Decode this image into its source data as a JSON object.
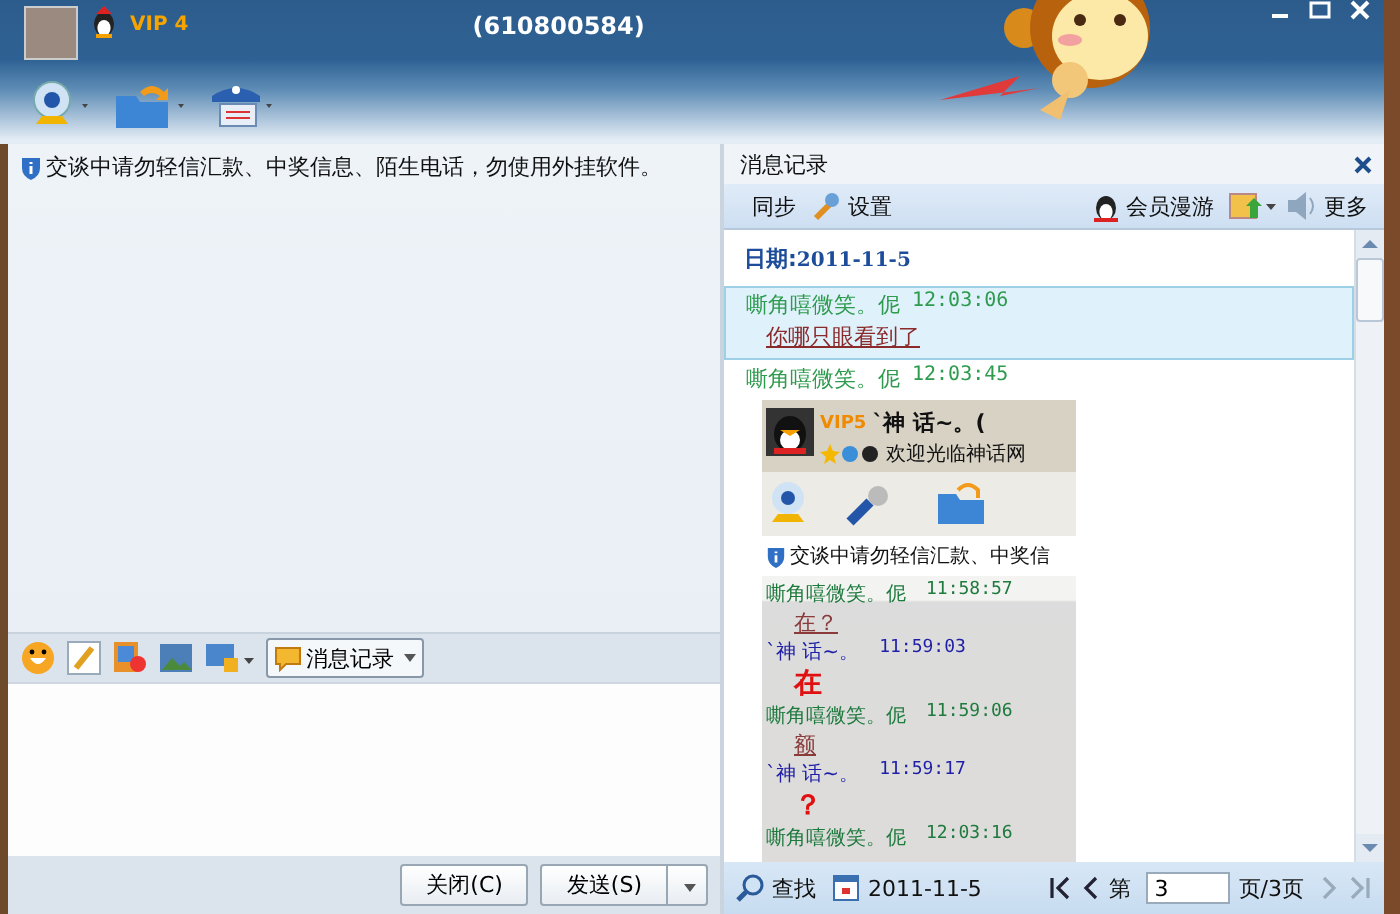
{
  "window": {
    "badge": "VIP 4",
    "title": "(610800584)"
  },
  "notice": "交谈中请勿轻信汇款、中奖信息、陌生电话，勿使用外挂软件。",
  "format_toolbar": {
    "history_button": "消息记录"
  },
  "buttons": [
    {
      "label": "关闭(C)",
      "kind": "plain"
    },
    {
      "label": "发送(S)",
      "kind": "split"
    }
  ],
  "history": {
    "title": "消息记录",
    "toolbar_left": [
      "同步",
      "设置"
    ],
    "toolbar_right": [
      "会员漫游",
      "更多"
    ],
    "date_label": "日期:",
    "date": "2011-11-5",
    "messages": [
      {
        "sender": "嘶角嘻微笑。伲",
        "time": "12:03:06",
        "kind": "text",
        "text": "你哪只眼看到了",
        "selected": true
      },
      {
        "sender": "嘶角嘻微笑。伲",
        "time": "12:03:45",
        "kind": "image",
        "selected": false
      }
    ],
    "image": {
      "badge": "VIP5",
      "name": "`神  话~。(",
      "status": "欢迎光临神话网",
      "notice": "交谈中请勿轻信汇款、中奖信",
      "messages": [
        {
          "sender": "嘶角嘻微笑。伲",
          "time": "11:58:57",
          "text": "在？",
          "kind": "mine"
        },
        {
          "sender": "`神  话~。",
          "time": "11:59:03",
          "text": "在",
          "kind": "theirs"
        },
        {
          "sender": "嘶角嘻微笑。伲",
          "time": "11:59:06",
          "text": "额",
          "kind": "mine"
        },
        {
          "sender": "`神  话~。",
          "time": "11:59:17",
          "text": "？",
          "kind": "theirs"
        },
        {
          "sender": "嘶角嘻微笑。伲",
          "time": "12:03:16",
          "kind": "mine"
        }
      ]
    },
    "footer": {
      "search": "查找",
      "date": "2011-11-5",
      "page_prefix": "第",
      "page": "3",
      "page_suffix": "页/3页"
    }
  }
}
